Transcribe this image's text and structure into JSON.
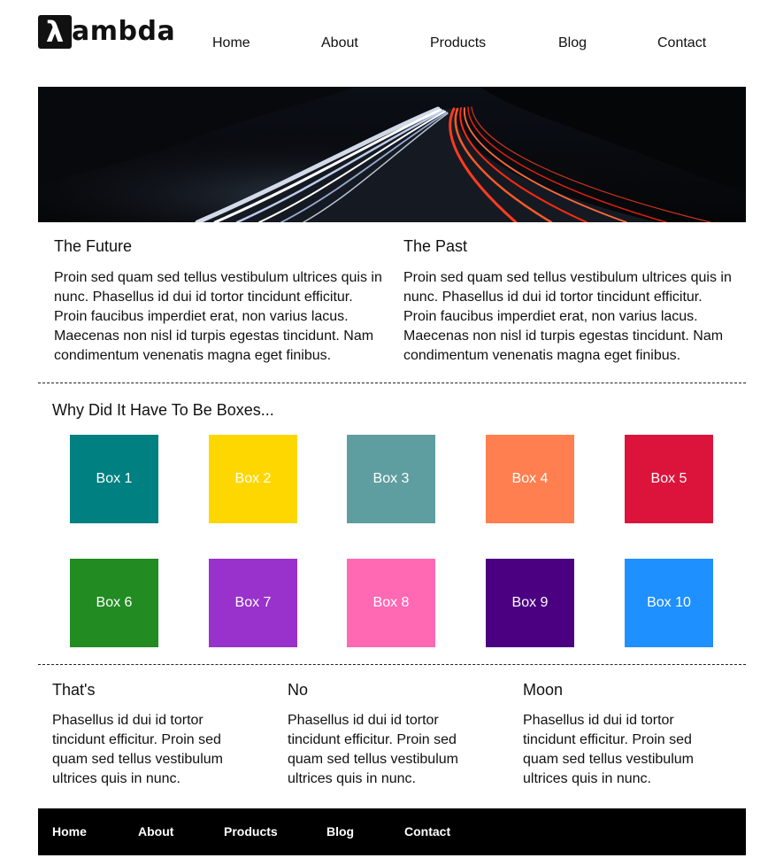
{
  "logo": {
    "mark": "λ",
    "text": "ambda"
  },
  "nav": {
    "items": [
      "Home",
      "About",
      "Products",
      "Blog",
      "Contact"
    ]
  },
  "hero": {
    "description": "long-exposure night highway light trails"
  },
  "columns": [
    {
      "title": "The Future",
      "text": "Proin sed quam sed tellus vestibulum ultrices quis in nunc. Phasellus id dui id tortor tincidunt efficitur. Proin faucibus imperdiet erat, non varius lacus. Maecenas non nisl id turpis egestas tincidunt. Nam condimentum venenatis magna eget finibus."
    },
    {
      "title": "The Past",
      "text": "Proin sed quam sed tellus vestibulum ultrices quis in nunc. Phasellus id dui id tortor tincidunt efficitur. Proin faucibus imperdiet erat, non varius lacus. Maecenas non nisl id turpis egestas tincidunt. Nam condimentum venenatis magna eget finibus."
    }
  ],
  "boxes": {
    "title": "Why Did It Have To Be Boxes...",
    "items": [
      {
        "label": "Box 1",
        "color": "#008080"
      },
      {
        "label": "Box 2",
        "color": "#FFD700"
      },
      {
        "label": "Box 3",
        "color": "#5F9EA0"
      },
      {
        "label": "Box 4",
        "color": "#FF7F50"
      },
      {
        "label": "Box 5",
        "color": "#DC143C"
      },
      {
        "label": "Box 6",
        "color": "#228B22"
      },
      {
        "label": "Box 7",
        "color": "#9932CC"
      },
      {
        "label": "Box 8",
        "color": "#FF69B4"
      },
      {
        "label": "Box 9",
        "color": "#4B0082"
      },
      {
        "label": "Box 10",
        "color": "#1E90FF"
      }
    ]
  },
  "bottom": [
    {
      "title": "That's",
      "text": "Phasellus id dui id tortor tincidunt efficitur. Proin sed quam sed tellus vestibulum ultrices quis in nunc."
    },
    {
      "title": "No",
      "text": "Phasellus id dui id tortor tincidunt efficitur. Proin sed quam sed tellus vestibulum ultrices quis in nunc."
    },
    {
      "title": "Moon",
      "text": "Phasellus id dui id tortor tincidunt efficitur. Proin sed quam sed tellus vestibulum ultrices quis in nunc."
    }
  ],
  "footer": {
    "items": [
      "Home",
      "About",
      "Products",
      "Blog",
      "Contact"
    ]
  }
}
